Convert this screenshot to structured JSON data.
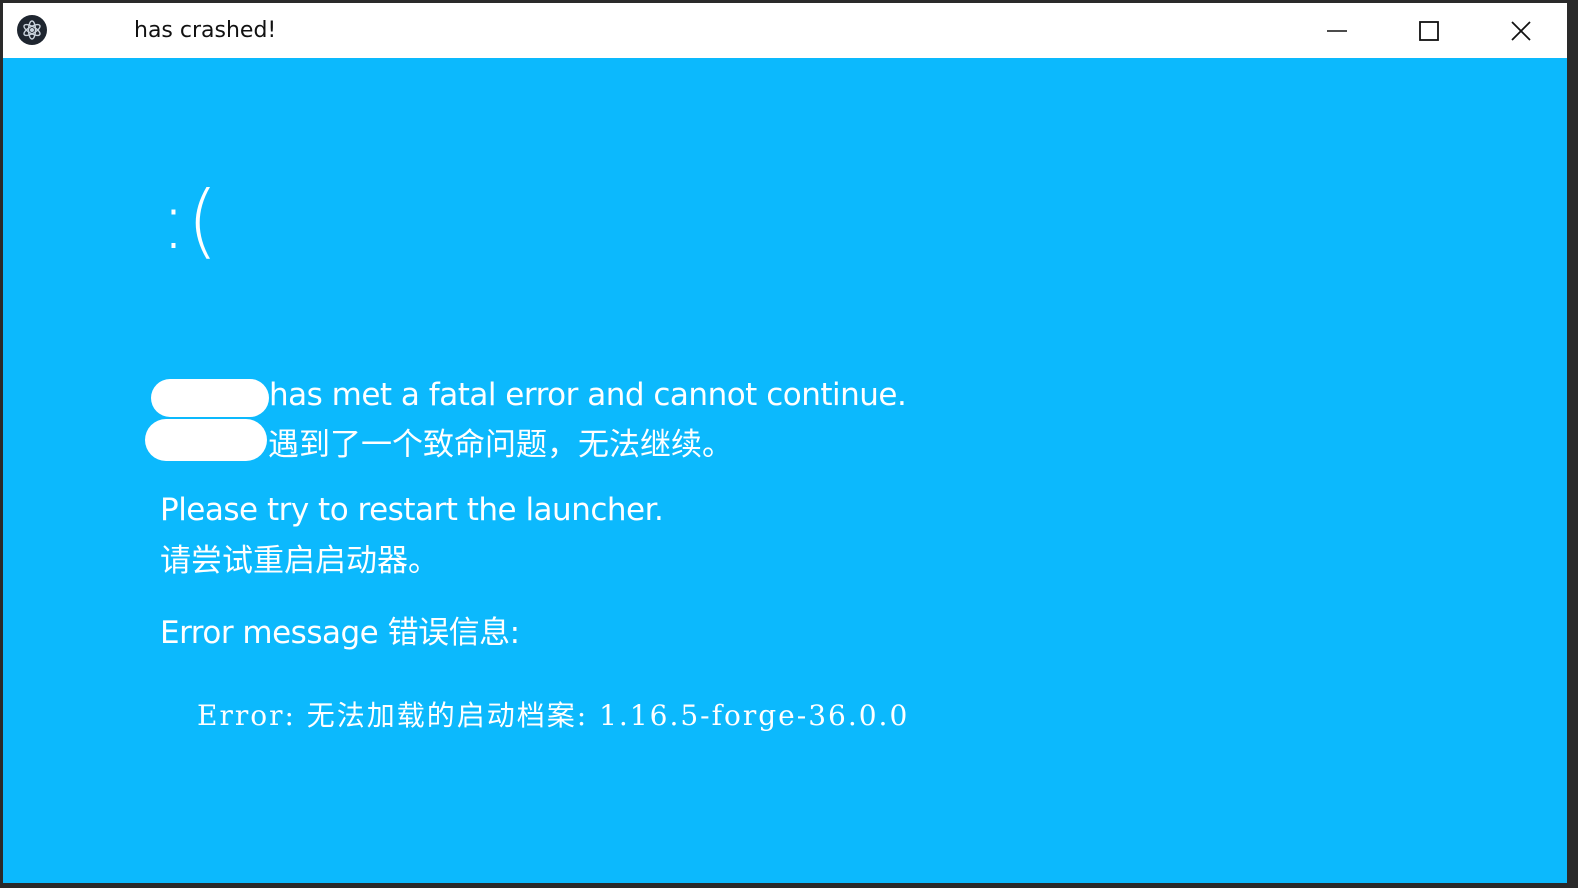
{
  "window": {
    "title": "has crashed!",
    "controls": {
      "minimize": "minimize-icon",
      "maximize": "maximize-icon",
      "close": "close-icon"
    },
    "colors": {
      "background": "#0cb9fd",
      "titlebar": "#ffffff",
      "text": "#ffffff"
    }
  },
  "crash": {
    "face": ":(",
    "fatal_en": "has met a fatal error and cannot continue.",
    "fatal_zh": "遇到了一个致命问题，无法继续。",
    "restart_en": "Please try to restart the launcher.",
    "restart_zh": "请尝试重启启动器。",
    "error_heading": "Error message 错误信息:",
    "error_detail": "Error: 无法加载的启动档案: 1.16.5-forge-36.0.0"
  }
}
